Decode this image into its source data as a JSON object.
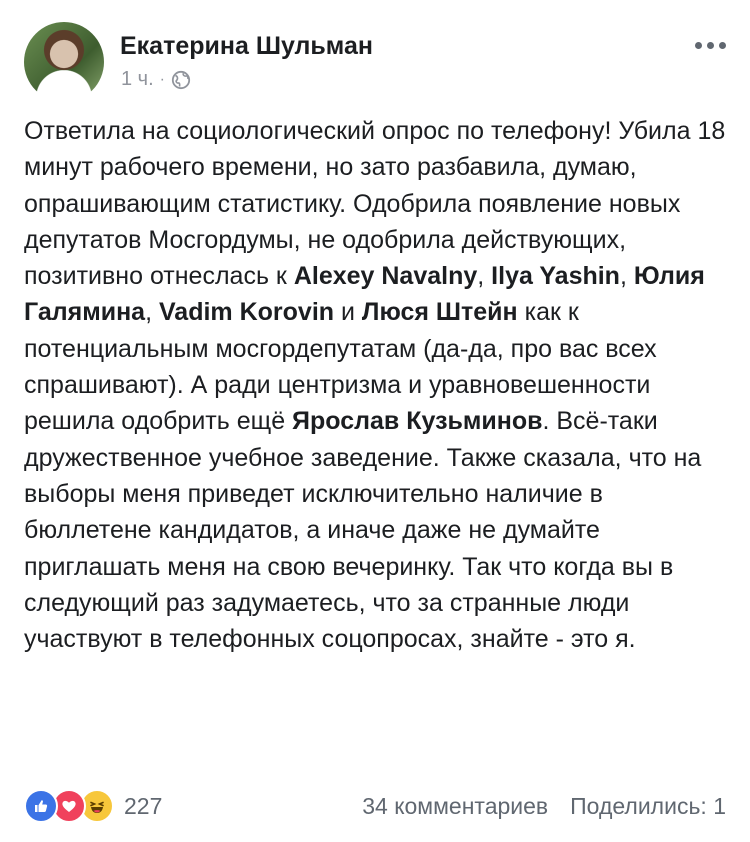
{
  "post": {
    "author": "Екатерина Шульман",
    "time": "1 ч.",
    "separator": "·",
    "privacy_icon": "globe-icon",
    "body": [
      {
        "t": "Ответила на социологический опрос по телефону! Убила 18 минут рабочего времени, но зато разбавила, думаю, опрашивающим статистику. Одобрила появление новых депутатов Мосгордумы, не одобрила действующих, позитивно отнеслась к "
      },
      {
        "m": "Alexey Navalny"
      },
      {
        "t": ", "
      },
      {
        "m": "Ilya Yashin"
      },
      {
        "t": ", "
      },
      {
        "m": "Юлия Галямина"
      },
      {
        "t": ", "
      },
      {
        "m": "Vadim Korovin"
      },
      {
        "t": " и "
      },
      {
        "m": "Люся Штейн"
      },
      {
        "t": " как к потенциальным мосгордепутатам (да-да, про вас всех спрашивают). А ради центризма и уравновешенности решила одобрить ещё "
      },
      {
        "m": "Ярослав Кузьминов"
      },
      {
        "t": ". Всё-таки дружественное учебное заведение. Также сказала, что на выборы меня приведет исключительно наличие в бюллетене кандидатов, а иначе даже не думайте приглашать меня на свою вечеринку.  Так что когда вы в следующий раз задумаетесь, что за странные люди участвуют в телефонных соцопросах, знайте - это я."
      }
    ]
  },
  "footer": {
    "reactions_count": "227",
    "reaction_icons": [
      "like-icon",
      "love-icon",
      "haha-icon"
    ],
    "comments": "34 комментариев",
    "shares": "Поделились: 1"
  },
  "colors": {
    "text": "#1c1e21",
    "secondary": "#90949c",
    "footer": "#606770",
    "like": "#3b73e6",
    "love": "#f0415c",
    "haha": "#f7c73b"
  }
}
